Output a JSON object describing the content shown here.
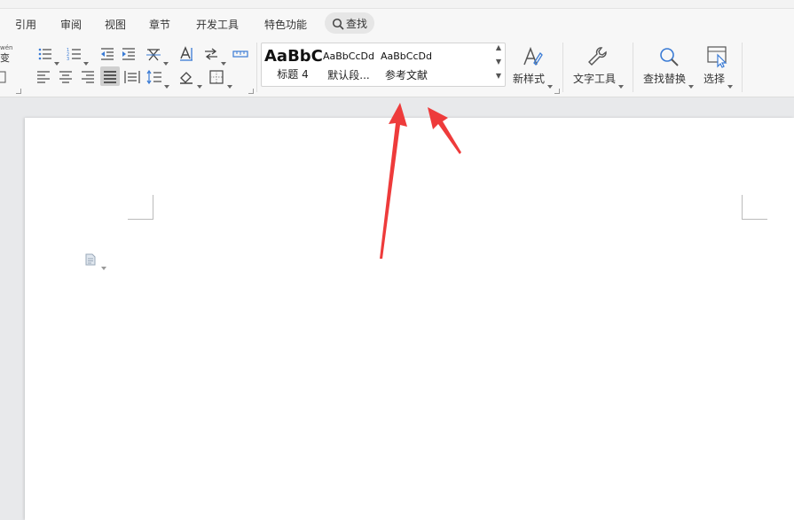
{
  "menu": {
    "tabs": [
      "引用",
      "审阅",
      "视图",
      "章节",
      "开发工具",
      "特色功能"
    ],
    "search_label": "查找"
  },
  "ribbon": {
    "pinyin_glyph_top": "wén",
    "pinyin_glyph_bottom": "变",
    "styles": [
      {
        "preview": "AaBbC",
        "name": "标题 4"
      },
      {
        "preview": "AaBbCcDd",
        "name": "默认段..."
      },
      {
        "preview": "AaBbCcDd",
        "name": "参考文献"
      }
    ],
    "new_style_label": "新样式",
    "text_tools_label": "文字工具",
    "find_replace_label": "查找替换",
    "select_label": "选择"
  },
  "colors": {
    "accent_arrow": "#ee3b3b",
    "ribbon_bg": "#f7f7f7",
    "page_bg": "#ffffff",
    "workspace_bg": "#e8e9eb",
    "icon_blue": "#3a7bd5"
  }
}
